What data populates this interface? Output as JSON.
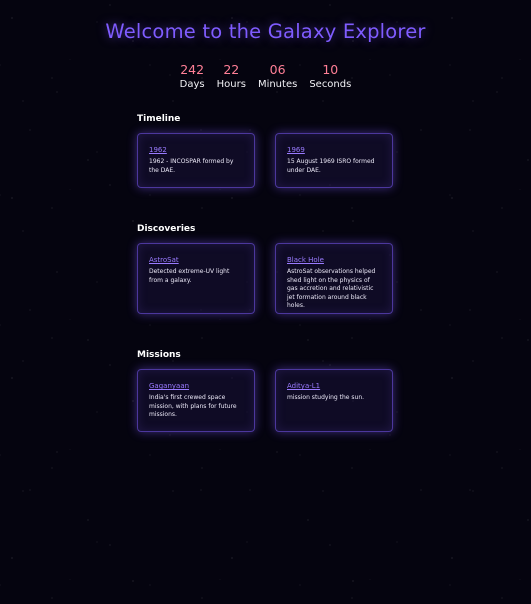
{
  "page": {
    "title": "Welcome to the Galaxy Explorer"
  },
  "countdown": [
    {
      "value": "242",
      "label": "Days"
    },
    {
      "value": "22",
      "label": "Hours"
    },
    {
      "value": "06",
      "label": "Minutes"
    },
    {
      "value": "10",
      "label": "Seconds"
    }
  ],
  "sections": {
    "timeline": {
      "title": "Timeline",
      "cards": [
        {
          "link": "1962",
          "text": "1962 - INCOSPAR formed by the DAE."
        },
        {
          "link": "1969",
          "text": "15 August 1969 ISRO formed under DAE."
        }
      ]
    },
    "discoveries": {
      "title": "Discoveries",
      "cards": [
        {
          "link": "AstroSat",
          "text": "Detected extreme-UV light from a galaxy."
        },
        {
          "link": "Black Hole",
          "text": "AstroSat observations helped shed light on the physics of gas accretion and relativistic jet formation around black holes."
        }
      ]
    },
    "missions": {
      "title": "Missions",
      "cards": [
        {
          "link": "Gaganyaan",
          "text": "India's first crewed space mission, with plans for future missions."
        },
        {
          "link": "Aditya-L1",
          "text": "mission studying the sun."
        }
      ]
    }
  },
  "colors": {
    "background": "#05040f",
    "accent": "#7f5cff",
    "countdown_number": "#ff7f96",
    "card_link": "#9a7bff"
  }
}
